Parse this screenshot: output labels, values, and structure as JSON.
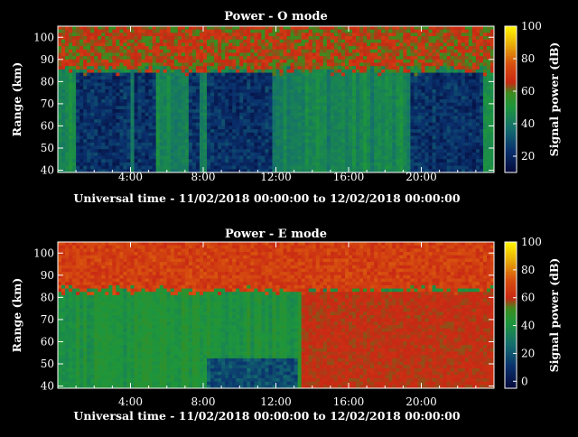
{
  "chart_data": [
    {
      "type": "heatmap",
      "title": "Power - O mode",
      "xlabel": "Universal time - 11/02/2018 00:00:00 to 12/02/2018 00:00:00",
      "ylabel": "Range (km)",
      "xlim": [
        0,
        24
      ],
      "ylim": [
        39,
        105
      ],
      "xticks": [
        "4:00",
        "8:00",
        "12:00",
        "16:00",
        "20:00"
      ],
      "xtick_values": [
        4,
        8,
        12,
        16,
        20
      ],
      "yticks": [
        "40",
        "50",
        "60",
        "70",
        "80",
        "90",
        "100"
      ],
      "ytick_values": [
        40,
        50,
        60,
        70,
        80,
        90,
        100
      ],
      "colorbar": {
        "label": "Signal power (dB)",
        "range": [
          10,
          100
        ],
        "ticks": [
          "20",
          "40",
          "60",
          "80",
          "100"
        ],
        "tick_values": [
          20,
          40,
          60,
          80,
          100
        ]
      },
      "profile": {
        "upper_layer_start_km": 85,
        "upper_layer_power_db": 62,
        "middle_power_db": 44,
        "lower_power_db": 22,
        "lower_region_top_km": 84,
        "low_power_intervals_ut": [
          [
            1,
            2
          ],
          [
            2,
            4
          ],
          [
            4.3,
            5.5
          ],
          [
            7.2,
            7.8
          ],
          [
            8.2,
            11.8
          ],
          [
            19.5,
            23.5
          ]
        ],
        "high_power_intervals_ut": []
      }
    },
    {
      "type": "heatmap",
      "title": "Power - E mode",
      "xlabel": "Universal time - 11/02/2018 00:00:00 to 12/02/2018 00:00:00",
      "ylabel": "Range (km)",
      "xlim": [
        0,
        24
      ],
      "ylim": [
        39,
        105
      ],
      "xticks": [
        "4:00",
        "8:00",
        "12:00",
        "16:00",
        "20:00"
      ],
      "xtick_values": [
        4,
        8,
        12,
        16,
        20
      ],
      "yticks": [
        "40",
        "50",
        "60",
        "70",
        "80",
        "90",
        "100"
      ],
      "ytick_values": [
        40,
        50,
        60,
        70,
        80,
        90,
        100
      ],
      "colorbar": {
        "label": "Signal power (dB)",
        "range": [
          -5,
          100
        ],
        "ticks": [
          "0",
          "20",
          "40",
          "60",
          "80",
          "100"
        ],
        "tick_values": [
          0,
          20,
          40,
          60,
          80,
          100
        ]
      },
      "profile": {
        "upper_layer_start_km": 83,
        "upper_layer_power_db": 65,
        "middle_power_db": 42,
        "lower_power_db": 18,
        "lower_region_top_km": 53,
        "low_power_intervals_ut": [
          [
            8.2,
            13.2
          ]
        ],
        "high_power_intervals_ut": [
          [
            13.4,
            24
          ],
          [
            18.7,
            19.0
          ]
        ]
      }
    }
  ]
}
